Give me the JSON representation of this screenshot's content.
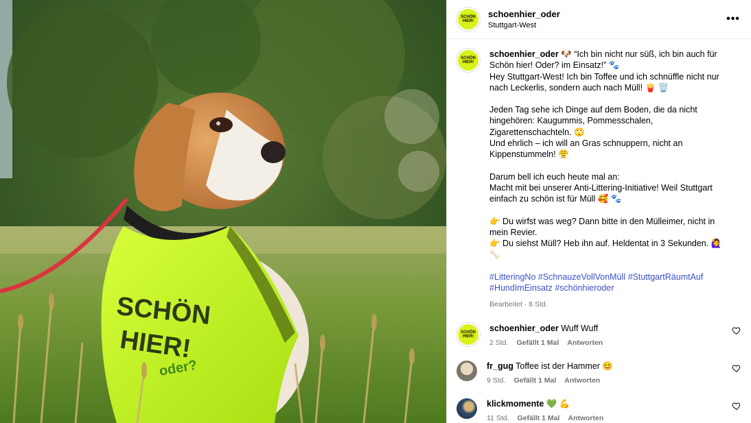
{
  "header": {
    "username": "schoenhier_oder",
    "location": "Stuttgart-West",
    "logo_text": "SCHÖN HIER!"
  },
  "photo": {
    "vest_text_1": "SCHÖN",
    "vest_text_2": "HIER!",
    "vest_text_3": "oder?"
  },
  "caption": {
    "username": "schoenhier_oder",
    "line1": " 🐶 “Ich bin nicht nur süß, ich bin auch für Schön hier! Oder? im Einsatz!” 🐾",
    "line2": "Hey Stuttgart-West! Ich bin Toffee und ich schnüffle nicht nur nach Leckerlis, sondern auch nach Müll! 🍟 🗑️",
    "line3": "Jeden Tag sehe ich Dinge auf dem Boden, die da nicht hingehören: Kaugummis, Pommesschalen, Zigarettenschachteln. 🙄",
    "line4": "Und ehrlich – ich will an Gras schnuppern, nicht an Kippenstummeln! 😤",
    "line5": "Darum bell ich euch heute mal an:",
    "line6": "Macht mit bei unserer Anti-Littering-Initiative! Weil Stuttgart einfach zu schön ist für Müll 🥰 🐾",
    "line7": "👉 Du wirfst was weg? Dann bitte in den Mülleimer, nicht in mein Revier.",
    "line8": "👉 Du siehst Müll? Heb ihn auf. Heldentat in 3 Sekunden. 🙋‍♀️ 🦴",
    "tags": [
      "#LitteringNo",
      "#SchnauzeVollVonMüll",
      "#StuttgartRäumtAuf",
      "#HundImEinsatz",
      "#schönhieroder"
    ],
    "meta": "Bearbeitet · 8 Std."
  },
  "comments": [
    {
      "username": "schoenhier_oder",
      "text": " Wuff Wuff",
      "time": "2 Std.",
      "likes": "Gefällt 1 Mal",
      "reply": "Antworten"
    },
    {
      "username": "fr_gug",
      "text": " Toffee ist der Hammer 😊",
      "time": "9 Std.",
      "likes": "Gefällt 1 Mal",
      "reply": "Antworten"
    },
    {
      "username": "klickmomente",
      "text": " 💚 💪",
      "time": "11 Std.",
      "likes": "Gefällt 1 Mal",
      "reply": "Antworten"
    }
  ],
  "colors": {
    "link": "#3b51c9",
    "muted": "#737373",
    "vest": "#c8f51e",
    "logo_bg": "#d9f21a"
  },
  "icons": {
    "more": "more-options-icon",
    "like": "heart-icon"
  }
}
